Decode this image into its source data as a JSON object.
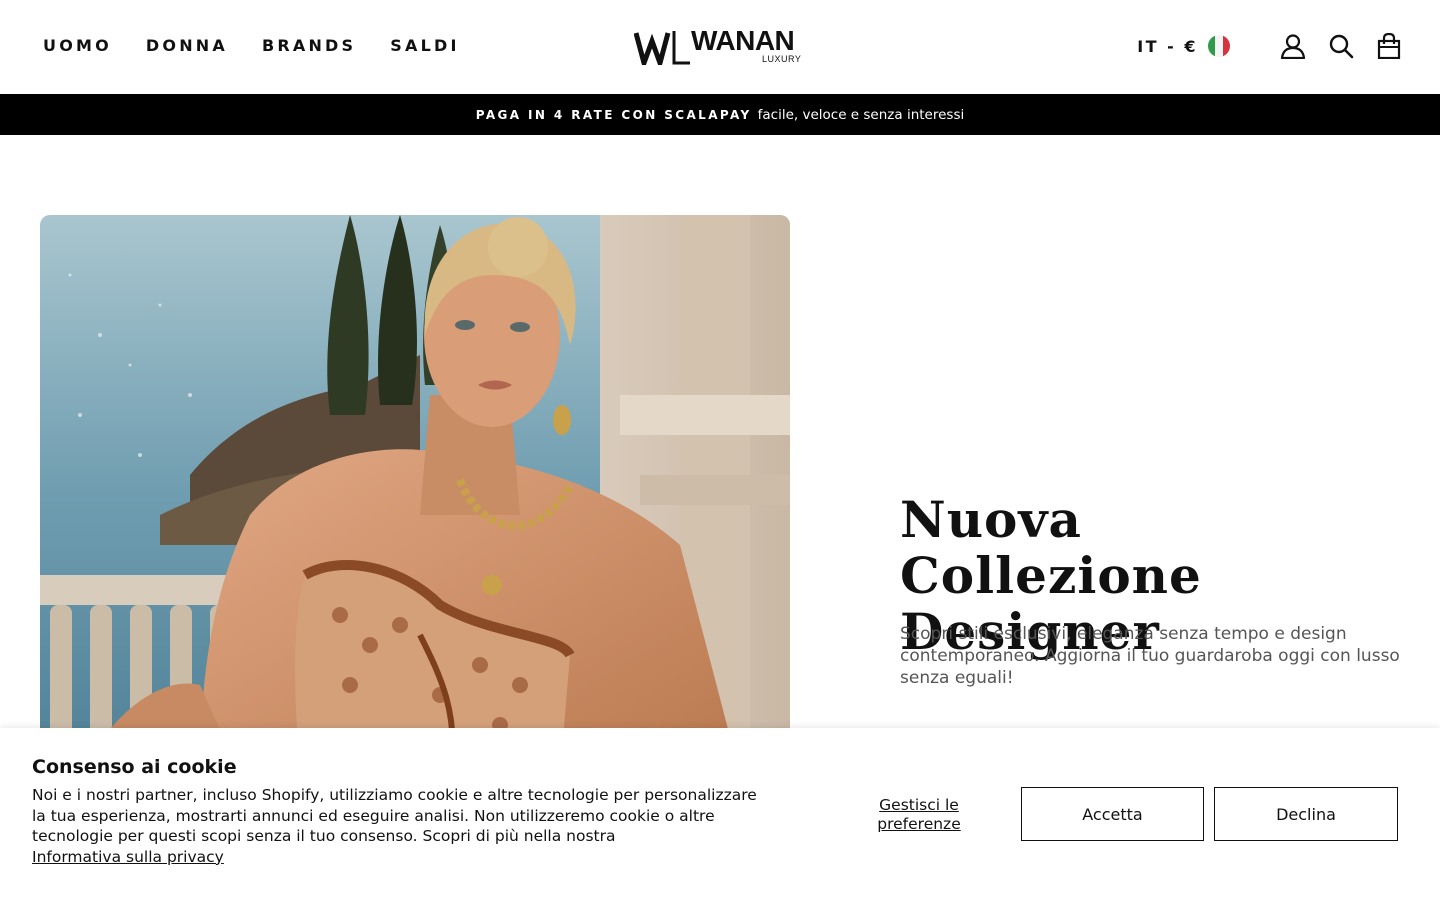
{
  "header": {
    "nav": [
      {
        "label": "UOMO"
      },
      {
        "label": "DONNA"
      },
      {
        "label": "BRANDS"
      },
      {
        "label": "SALDI"
      }
    ],
    "logo": {
      "text": "WANAN",
      "sub": "LUXURY"
    },
    "locale": "IT - €",
    "icons": [
      "account-icon",
      "search-icon",
      "cart-icon"
    ]
  },
  "promo": {
    "strong": "PAGA IN 4 RATE CON SCALAPAY",
    "light": "facile, veloce e senza interessi"
  },
  "hero": {
    "title_line1": "Nuova Collezione",
    "title_line2": "Designer",
    "description": "Scopri stili esclusivi, eleganza senza tempo e design contemporaneo. Aggiorna il tuo guardaroba oggi con lusso senza eguali!"
  },
  "cookie": {
    "title": "Consenso ai cookie",
    "text": "Noi e i nostri partner, incluso Shopify, utilizziamo cookie e altre tecnologie per personalizzare la tua esperienza, mostrarti annunci ed eseguire analisi. Non utilizzeremo cookie o altre tecnologie per questi scopi senza il tuo consenso. Scopri di più nella nostra",
    "privacy_link": "Informativa sulla privacy",
    "manage_label": "Gestisci le preferenze",
    "accept_label": "Accetta",
    "decline_label": "Declina"
  },
  "colors": {
    "promo_bg": "#000000",
    "flag_green": "#2e9a4a",
    "flag_white": "#f4f4f4",
    "flag_red": "#d7333c"
  }
}
